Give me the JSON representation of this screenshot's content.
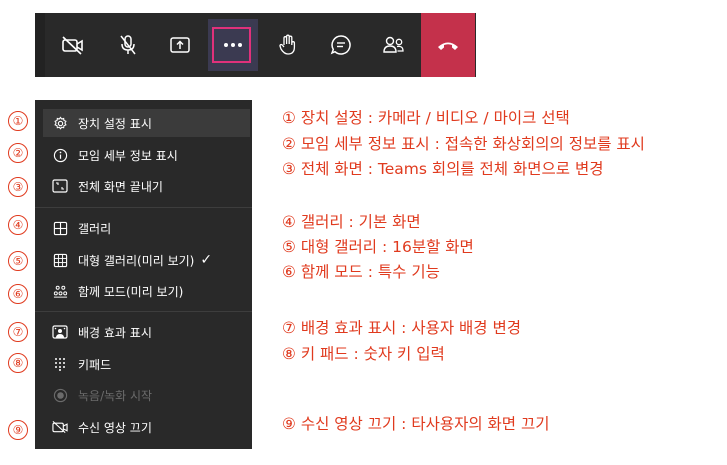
{
  "toolbar": {
    "buttons": [
      {
        "icon": "camera-off-icon"
      },
      {
        "icon": "mic-off-icon"
      },
      {
        "icon": "share-screen-icon"
      },
      {
        "icon": "more-options-icon"
      },
      {
        "icon": "raise-hand-icon"
      },
      {
        "icon": "chat-icon"
      },
      {
        "icon": "participants-icon"
      },
      {
        "icon": "hang-up-icon"
      }
    ],
    "highlight_color": "#e0317b",
    "hangup_color": "#c4314b"
  },
  "menu": {
    "items": [
      {
        "label": "장치 설정 표시"
      },
      {
        "label": "모임 세부 정보 표시"
      },
      {
        "label": "전체 화면 끝내기"
      },
      {
        "label": "갤러리"
      },
      {
        "label": "대형 갤러리(미리 보기)",
        "check": "✓"
      },
      {
        "label": "함께 모드(미리 보기)"
      },
      {
        "label": "배경 효과 표시"
      },
      {
        "label": "키패드"
      },
      {
        "label": "녹음/녹화 시작"
      },
      {
        "label": "수신 영상 끄기"
      }
    ]
  },
  "markers": [
    "①",
    "②",
    "③",
    "④",
    "⑤",
    "⑥",
    "⑦",
    "⑧",
    "⑨"
  ],
  "descriptions": [
    "① 장치 설정 : 카메라 / 비디오 / 마이크 선택",
    "② 모임 세부 정보 표시 : 접속한 화상회의의 정보를 표시",
    "③ 전체 화면 : Teams 회의를 전체 화면으로 변경",
    "④ 갤러리 : 기본 화면",
    "⑤ 대형 갤러리 : 16분할 화면",
    "⑥ 함께 모드 : 특수 기능",
    "⑦ 배경 효과 표시 : 사용자 배경 변경",
    "⑧ 키 패드 : 숫자 키 입력",
    "⑨ 수신 영상 끄기 : 타사용자의 화면 끄기"
  ],
  "accent_color": "#e03a1e"
}
